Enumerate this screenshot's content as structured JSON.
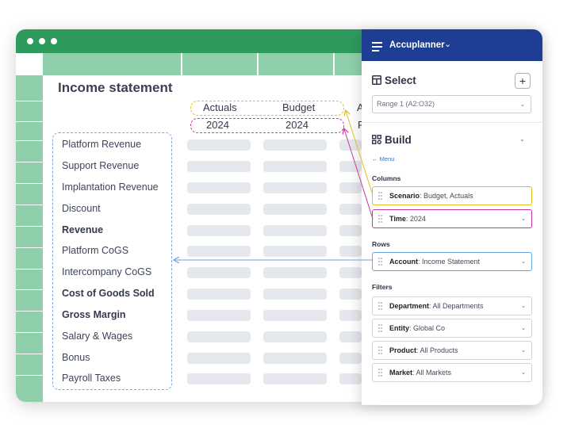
{
  "sheet": {
    "title": "Income statement",
    "header_row1": [
      "Actuals",
      "Budget",
      "A"
    ],
    "header_row2": [
      "2024",
      "2024",
      "F"
    ],
    "rows": [
      {
        "label": "Platform Revenue",
        "bold": false
      },
      {
        "label": "Support Revenue",
        "bold": false
      },
      {
        "label": "Implantation Revenue",
        "bold": false
      },
      {
        "label": "Discount",
        "bold": false
      },
      {
        "label": "Revenue",
        "bold": true
      },
      {
        "label": "Platform CoGS",
        "bold": false
      },
      {
        "label": "Intercompany CoGS",
        "bold": false
      },
      {
        "label": "Cost of Goods Sold",
        "bold": true
      },
      {
        "label": "Gross Margin",
        "bold": true
      },
      {
        "label": "Salary & Wages",
        "bold": false
      },
      {
        "label": "Bonus",
        "bold": false
      },
      {
        "label": "Payroll Taxes",
        "bold": false
      }
    ]
  },
  "panel": {
    "app_title": "Accuplanner",
    "select_section": {
      "title": "Select",
      "add_label": "+",
      "range_value": "Range 1 (A2:O32)"
    },
    "build_section": {
      "title": "Build",
      "menu_link": "← Menu"
    },
    "groups": {
      "columns": "Columns",
      "rows": "Rows",
      "filters": "Filters"
    },
    "columns": [
      {
        "name": "Scenario",
        "value": ": Budget, Actuals"
      },
      {
        "name": "Time",
        "value": ": 2024"
      }
    ],
    "rows": [
      {
        "name": "Account",
        "value": ": Income Statement"
      }
    ],
    "filters": [
      {
        "name": "Department",
        "value": ": All Departments"
      },
      {
        "name": "Entity",
        "value": ": Global Co"
      },
      {
        "name": "Product",
        "value": ": All Products"
      },
      {
        "name": "Market",
        "value": ": All Markets"
      }
    ]
  },
  "colors": {
    "titlebar": "#2e9a5e",
    "grid_header": "#8fcfaa",
    "panel_header": "#1d3e92",
    "columns_scenario": "#e2bc1f",
    "columns_time": "#c938a0",
    "rows_account": "#6aa5e6"
  }
}
